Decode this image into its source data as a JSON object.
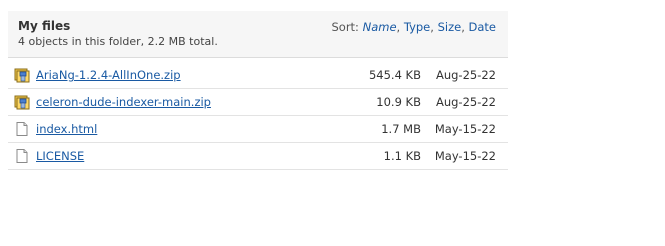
{
  "header": {
    "title": "My files",
    "summary": "4 objects in this folder, 2.2 MB total."
  },
  "sort": {
    "label": "Sort:",
    "options": [
      {
        "label": "Name",
        "active": true
      },
      {
        "label": "Type",
        "active": false
      },
      {
        "label": "Size",
        "active": false
      },
      {
        "label": "Date",
        "active": false
      }
    ],
    "separator": ","
  },
  "files": [
    {
      "name": "AriaNg-1.2.4-AllInOne.zip",
      "size": "545.4 KB",
      "date": "Aug-25-22",
      "icon": "zip-archive-icon"
    },
    {
      "name": "celeron-dude-indexer-main.zip",
      "size": "10.9 KB",
      "date": "Aug-25-22",
      "icon": "zip-archive-icon"
    },
    {
      "name": "index.html",
      "size": "1.7 MB",
      "date": "May-15-22",
      "icon": "document-icon"
    },
    {
      "name": "LICENSE",
      "size": "1.1 KB",
      "date": "May-15-22",
      "icon": "document-icon"
    }
  ],
  "colors": {
    "link": "#1a5aa3",
    "header_bg": "#f6f6f6",
    "row_border": "#e3e3e3"
  }
}
